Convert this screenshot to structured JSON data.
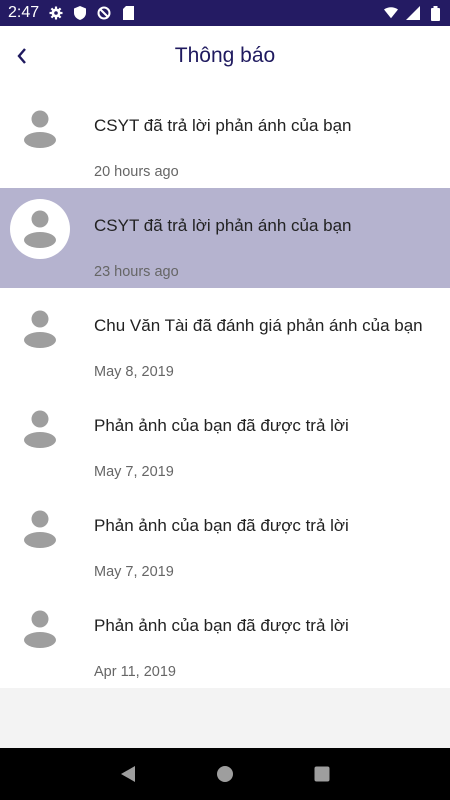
{
  "status_bar": {
    "time": "2:47",
    "left_icons": [
      "gear-icon",
      "shield-icon",
      "blocked-circle-icon",
      "sd-card-icon"
    ],
    "right_icons": [
      "wifi-icon",
      "signal-icon",
      "battery-icon"
    ]
  },
  "header": {
    "title": "Thông báo",
    "back_icon": "chevron-left-icon"
  },
  "notifications": [
    {
      "title": "CSYT đã trả lời phản ánh của bạn",
      "time": "20 hours ago",
      "selected": false
    },
    {
      "title": "CSYT đã trả lời phản ánh của bạn",
      "time": "23 hours ago",
      "selected": true
    },
    {
      "title": "Chu Văn Tài đã đánh giá phản ánh của bạn",
      "time": "May 8, 2019",
      "selected": false
    },
    {
      "title": "Phản ảnh của bạn đã được trả lời",
      "time": "May 7, 2019",
      "selected": false
    },
    {
      "title": "Phản ảnh của bạn đã được trả lời",
      "time": "May 7, 2019",
      "selected": false
    },
    {
      "title": "Phản ảnh của bạn đã được trả lời",
      "time": "Apr 11, 2019",
      "selected": false
    }
  ],
  "nav_bar": {
    "back_icon": "triangle-back-icon",
    "home_icon": "circle-home-icon",
    "recents_icon": "square-recents-icon"
  },
  "colors": {
    "status_bar": "#241b63",
    "title": "#1f1a5f",
    "selected_row": "#b5b3cf",
    "avatar": "#9e9e9e"
  }
}
